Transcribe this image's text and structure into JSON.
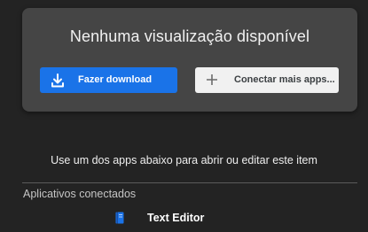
{
  "preview": {
    "title": "Nenhuma visualização disponível",
    "download_label": "Fazer download",
    "download_icon": "download-icon",
    "connect_label": "Conectar mais apps...",
    "connect_icon": "plus-icon"
  },
  "hint": "Use um dos apps abaixo para abrir ou editar este item",
  "connected_apps": {
    "title": "Aplicativos conectados",
    "items": [
      {
        "label": "Text Editor",
        "icon": "text-editor-icon"
      }
    ]
  },
  "colors": {
    "background": "#232323",
    "card": "#454545",
    "primary_button": "#1a73e8",
    "secondary_button": "#f1f1f1",
    "app_icon": "#1a73e8"
  }
}
